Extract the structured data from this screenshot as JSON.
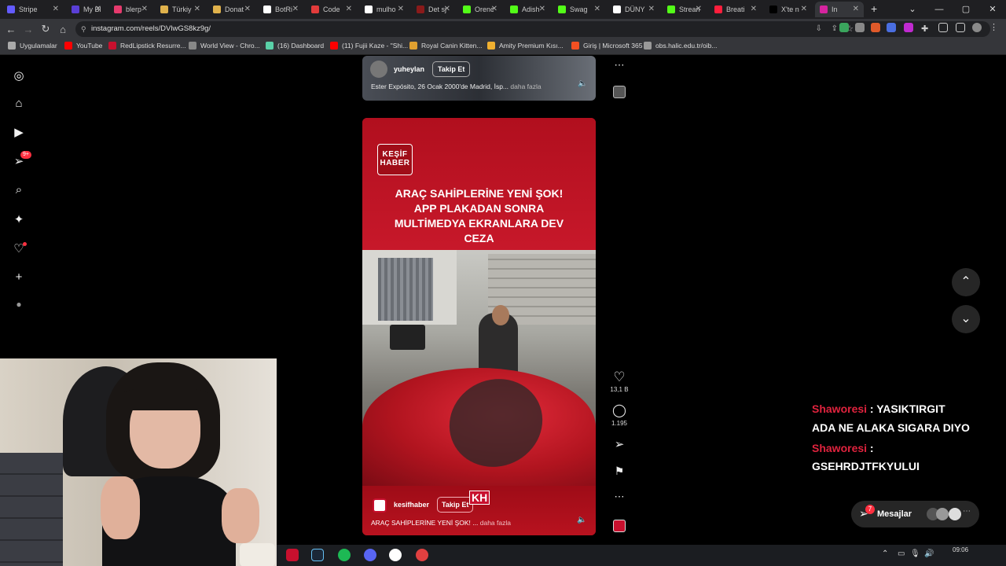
{
  "browser": {
    "tabs": [
      {
        "label": "Stripe",
        "color": "#635bff"
      },
      {
        "label": "My Bl",
        "color": "#5a3fd6"
      },
      {
        "label": "blerp",
        "color": "#e63a6d"
      },
      {
        "label": "Türkiy",
        "color": "#e0b24c"
      },
      {
        "label": "Donat",
        "color": "#e0b24c"
      },
      {
        "label": "BotRi",
        "color": "#ffffff"
      },
      {
        "label": "Code",
        "color": "#e23b3b"
      },
      {
        "label": "mulho",
        "color": "#ffffff"
      },
      {
        "label": "Det sj",
        "color": "#8a1a1a"
      },
      {
        "label": "Orenc",
        "color": "#53fc18"
      },
      {
        "label": "Adish",
        "color": "#53fc18"
      },
      {
        "label": "Swag",
        "color": "#53fc18"
      },
      {
        "label": "DÜNY",
        "color": "#ffffff"
      },
      {
        "label": "Strean",
        "color": "#53fc18"
      },
      {
        "label": "Breati",
        "color": "#ff1e3c"
      },
      {
        "label": "X'te n",
        "color": "#000000"
      },
      {
        "label": "In",
        "color": "#d6249f"
      }
    ],
    "window_controls": [
      "⌄",
      "—",
      "▢",
      "✕"
    ],
    "new_tab": "+",
    "url": "instagram.com/reels/DVlwGS8kz9g/",
    "bookmarks": [
      {
        "label": "Uygulamalar",
        "color": "#aaaaaa"
      },
      {
        "label": "YouTube",
        "color": "#ff0000"
      },
      {
        "label": "RedLipstick Resurre...",
        "color": "#c8102e"
      },
      {
        "label": "World View - Chro...",
        "color": "#888888"
      },
      {
        "label": "(16) Dashboard",
        "color": "#5ad1a8"
      },
      {
        "label": "(11) Fujii Kaze - \"Shi...",
        "color": "#ff0000"
      },
      {
        "label": "Royal Canin Kitten...",
        "color": "#e0a030"
      },
      {
        "label": "Amity Premium Kısı...",
        "color": "#f0b030"
      },
      {
        "label": "Giriş | Microsoft 365",
        "color": "#f25022"
      },
      {
        "label": "obs.halic.edu.tr/oib...",
        "color": "#999999"
      }
    ]
  },
  "sidebar": {
    "items": [
      {
        "icon": "instagram-logo-icon",
        "glyph": "◎"
      },
      {
        "icon": "home-icon",
        "glyph": "⌂"
      },
      {
        "icon": "reels-icon",
        "glyph": "▶"
      },
      {
        "icon": "direct-messages-icon",
        "glyph": "➢",
        "badge": "9+"
      },
      {
        "icon": "search-icon",
        "glyph": "⌕"
      },
      {
        "icon": "explore-icon",
        "glyph": "✦"
      },
      {
        "icon": "notifications-icon",
        "glyph": "♡"
      },
      {
        "icon": "create-icon",
        "glyph": "+"
      },
      {
        "icon": "profile-avatar-icon",
        "glyph": "●"
      }
    ]
  },
  "reel_top": {
    "username": "yuheylan",
    "follow_label": "Takip Et",
    "caption": "Ester Expósito, 26 Ocak 2000'de Madrid, İsp...",
    "more_label": "daha fazla"
  },
  "reel_main": {
    "brand_line1": "KEŞİF",
    "brand_line2": "HABER",
    "headline": [
      "ARAÇ SAHİPLERİNE YENİ ŞOK!",
      "APP PLAKADAN SONRA",
      "MULTİMEDYA EKRANLARA DEV",
      "CEZA"
    ],
    "username": "kesifhaber",
    "follow_label": "Takip Et",
    "watermark": "KH",
    "caption": "ARAÇ SAHİPLERİNE YENİ ŞOK! ...",
    "more_label": "daha fazla",
    "accent": "#c8102e"
  },
  "actions": {
    "like_count": "13,1 B",
    "comment_count": "1.195"
  },
  "chat": [
    {
      "user": "Shaworesi",
      "message": "YASIKTIRGIT"
    },
    {
      "user": "",
      "message": "ADA NE ALAKA SIGARA DIYO"
    },
    {
      "user": "Shaworesi",
      "message": ""
    },
    {
      "user": "",
      "message": "GSEHRDJTFKYULUI"
    }
  ],
  "messages_bar": {
    "label": "Mesajlar",
    "badge": "7"
  },
  "taskbar": {
    "time": "09:06"
  }
}
